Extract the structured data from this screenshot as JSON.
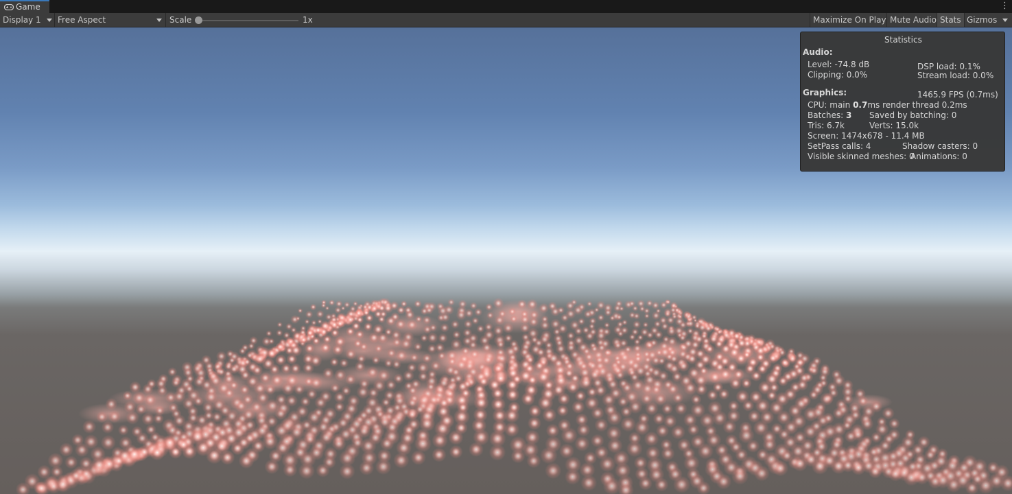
{
  "tab": {
    "label": "Game",
    "icon": "gamepad-icon"
  },
  "toolbar": {
    "display": "Display 1",
    "aspect": "Free Aspect",
    "scale_label": "Scale",
    "scale_value": "1x",
    "scale_level": 0.0,
    "maximize": "Maximize On Play",
    "mute": "Mute Audio",
    "stats": "Stats",
    "gizmos": "Gizmos"
  },
  "stats": {
    "title": "Statistics",
    "audio_header": "Audio:",
    "level": "Level: -74.8 dB",
    "clipping": "Clipping: 0.0%",
    "dsp": "DSP load: 0.1%",
    "stream": "Stream load: 0.0%",
    "graphics_header": "Graphics:",
    "fps": "1465.9 FPS (0.7ms)",
    "cpu_prefix": "CPU: main ",
    "cpu_main": "0.7",
    "cpu_suffix": "ms  render thread 0.2ms",
    "batches_prefix": "Batches: ",
    "batches": "3",
    "saved": "Saved by batching: 0",
    "tris": "Tris: 6.7k",
    "verts": "Verts: 15.0k",
    "screen": "Screen: 1474x678 - 11.4 MB",
    "setpass": "SetPass calls: 4",
    "shadow": "Shadow casters: 0",
    "skinned": "Visible skinned meshes: 0",
    "animations": "Animations: 0"
  },
  "colors": {
    "particle": "#ff9a92",
    "particle_core": "#fff4f0",
    "accent": "#3a79bb"
  }
}
